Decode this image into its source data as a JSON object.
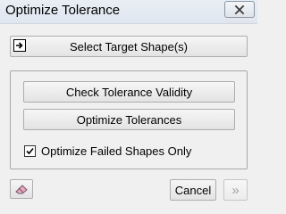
{
  "window": {
    "title": "Optimize Tolerance"
  },
  "titlebar": {
    "close_icon": "close-x-icon"
  },
  "select_target": {
    "label": "Select Target Shape(s)",
    "icon": "select-arrow-icon"
  },
  "group": {
    "check_validity_label": "Check Tolerance Validity",
    "optimize_label": "Optimize Tolerances",
    "checkbox": {
      "label": "Optimize Failed Shapes Only",
      "checked": true
    }
  },
  "footer": {
    "eraser_icon": "eraser-icon",
    "cancel_label": "Cancel",
    "next_glyph": "»",
    "next_enabled": false
  }
}
